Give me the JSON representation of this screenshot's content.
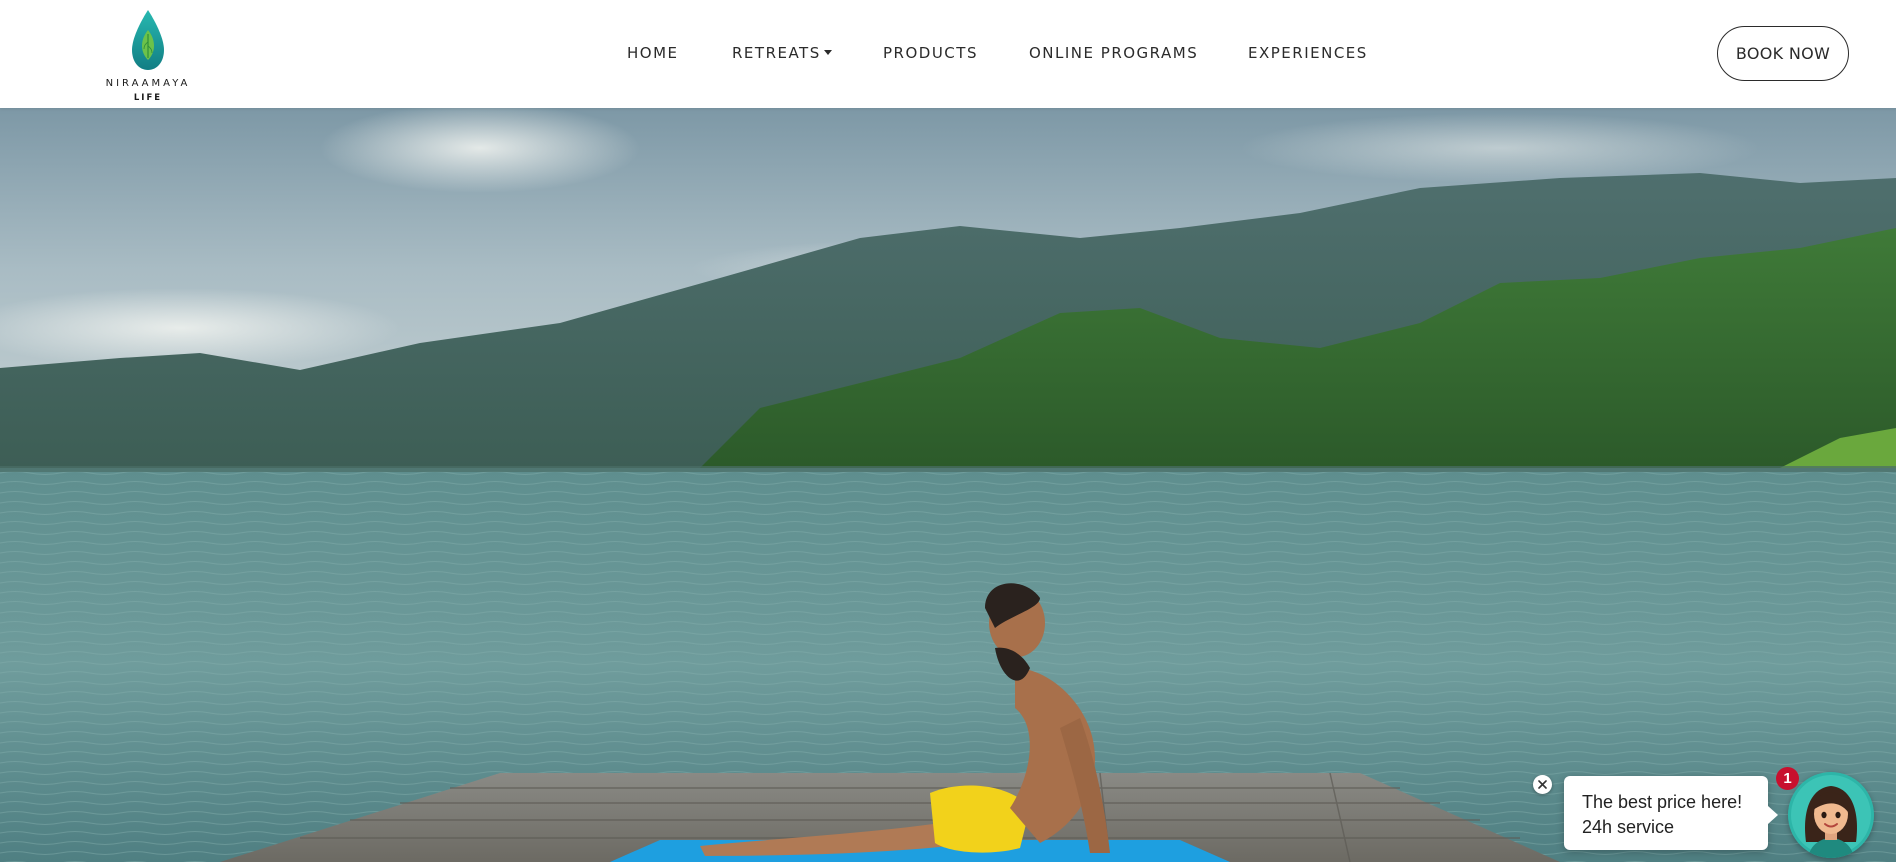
{
  "brand": {
    "name": "NIRAAMAYA",
    "sub": "LIFE",
    "logo_icon": "water-drop-leaf-icon",
    "colors": {
      "teal": "#1aa6a0",
      "green": "#5cbf3a"
    }
  },
  "nav": {
    "items": [
      {
        "label": "HOME"
      },
      {
        "label": "RETREATS",
        "has_dropdown": true
      },
      {
        "label": "PRODUCTS"
      },
      {
        "label": "ONLINE PROGRAMS"
      },
      {
        "label": "EXPERIENCES"
      }
    ]
  },
  "cta": {
    "book_label": "BOOK NOW"
  },
  "hero": {
    "image": "yoga-on-lake-dock-photo"
  },
  "chat": {
    "line1": "The best price here!",
    "line2": "24h service",
    "badge_count": "1",
    "close_icon": "close-icon",
    "avatar_icon": "assistant-avatar-icon",
    "badge_color": "#c8102e"
  }
}
